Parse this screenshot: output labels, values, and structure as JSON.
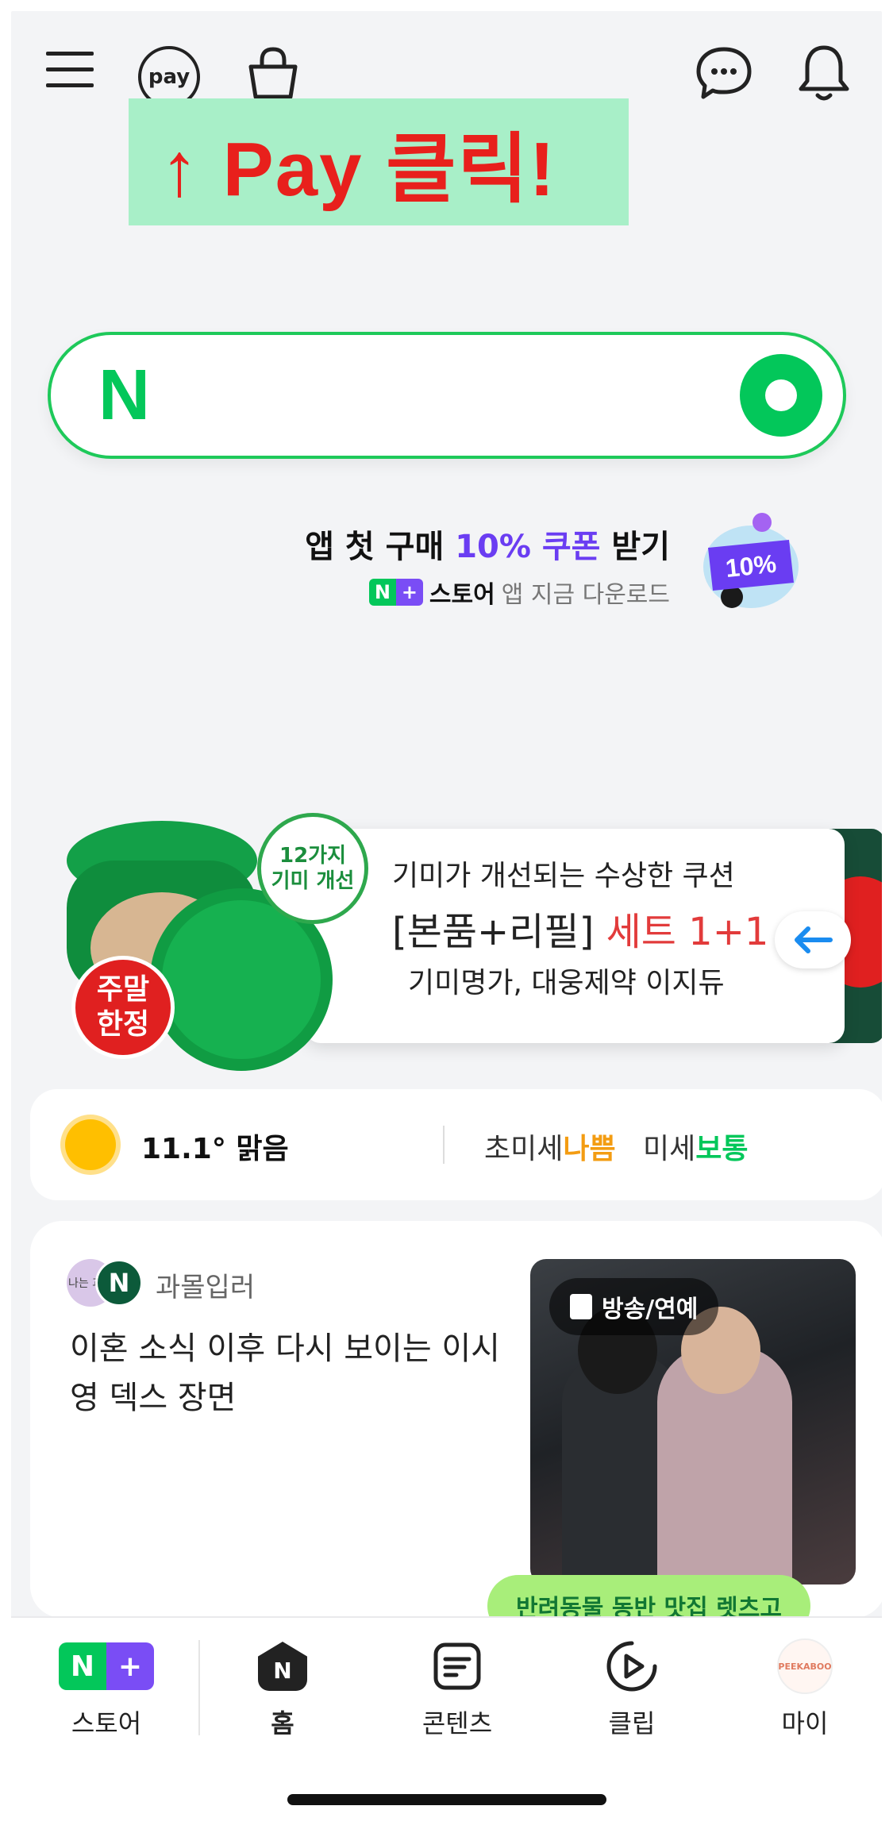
{
  "header": {
    "menu_icon": "hamburger-icon",
    "pay_label": "pay",
    "cart_icon": "shopping-bag-icon",
    "chat_icon": "chat-bubble-icon",
    "bell_icon": "bell-icon"
  },
  "annotation": {
    "text": "↑ Pay 클릭!",
    "bg_color": "#a8efc8",
    "text_color": "#e8201c"
  },
  "search": {
    "logo": "N",
    "value": "",
    "accent": "#03c75a"
  },
  "promo": {
    "line1_prefix": "앱 첫 구매 ",
    "line1_highlight": "10% 쿠폰",
    "line1_suffix": " 받기",
    "badge_n": "N",
    "badge_plus": "+",
    "store_label": "스토어",
    "line2_suffix": "앱 지금 다운로드",
    "coupon_label": "10%",
    "highlight_color": "#6a3df2"
  },
  "ad": {
    "line1": "기미가 개선되는 수상한 쿠션",
    "line2_prefix": "[본품+리필] ",
    "line2_highlight": "세트 1+1",
    "line3": "기미명가, 대웅제약 이지듀",
    "brand": "Easydew",
    "badge_top_1": "12가지",
    "badge_top_2": "기미 개선",
    "badge_weekend_1": "주말",
    "badge_weekend_2": "한정"
  },
  "weather": {
    "temperature": "11.1°",
    "condition": "맑음",
    "ultrafine_label": "초미세",
    "ultrafine_status": "나쁨",
    "fine_label": "미세",
    "fine_status": "보통",
    "bad_color": "#f39c12",
    "ok_color": "#03c75a"
  },
  "news": {
    "source_avatar_text": "나는 과몰",
    "source_badge": "N",
    "source": "과몰입러",
    "headline": "이혼 소식 이후 다시 보이는 이시영 덱스 장면",
    "tag": "방송/연예"
  },
  "tooltip": {
    "text": "반려동물 동반 맛집 렛츠고"
  },
  "bottom_nav": {
    "items": [
      {
        "label": "스토어",
        "icon": "store-n-plus-icon"
      },
      {
        "label": "홈",
        "icon": "home-icon",
        "active": true
      },
      {
        "label": "콘텐츠",
        "icon": "contents-icon"
      },
      {
        "label": "클립",
        "icon": "clip-play-icon"
      },
      {
        "label": "마이",
        "icon": "profile-avatar"
      }
    ],
    "my_avatar_text": "PEEKABOO"
  }
}
